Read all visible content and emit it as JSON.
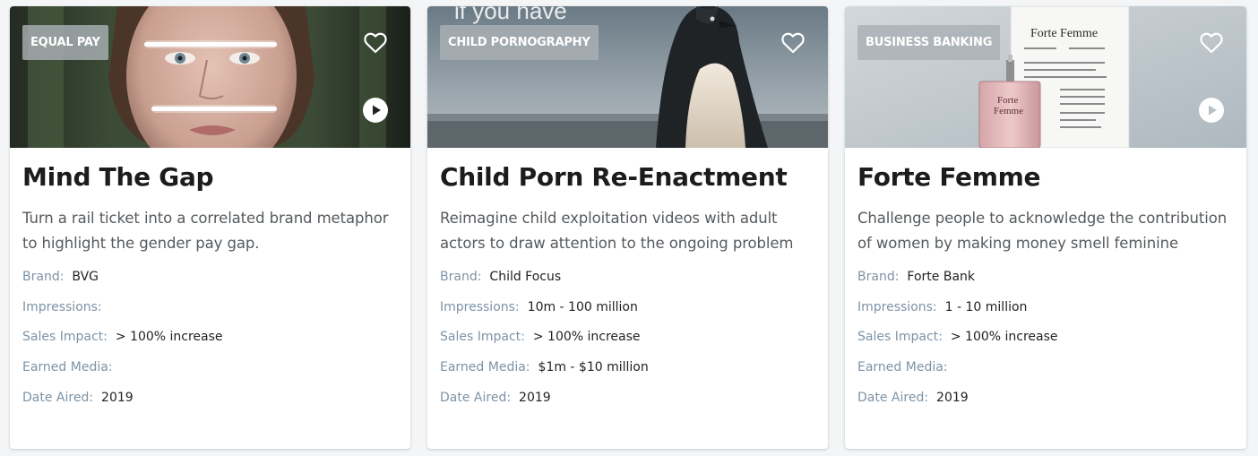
{
  "cards": [
    {
      "tag": "EQUAL PAY",
      "title": "Mind The Gap",
      "description": "Turn a rail ticket into a correlated brand metaphor to highlight the gender pay gap.",
      "fields": [
        {
          "label": "Brand:",
          "value": "BVG"
        },
        {
          "label": "Impressions:",
          "value": ""
        },
        {
          "label": "Sales Impact:",
          "value": "> 100% increase"
        },
        {
          "label": "Earned Media:",
          "value": ""
        },
        {
          "label": "Date Aired:",
          "value": "2019"
        }
      ],
      "has_video": true
    },
    {
      "tag": "CHILD PORNOGRAPHY",
      "title": "Child Porn Re-Enactment",
      "description": "Reimagine child exploitation videos with adult actors to draw attention to the ongoing problem",
      "fields": [
        {
          "label": "Brand:",
          "value": "Child Focus"
        },
        {
          "label": "Impressions:",
          "value": "10m - 100 million"
        },
        {
          "label": "Sales Impact:",
          "value": "> 100% increase"
        },
        {
          "label": "Earned Media:",
          "value": "$1m - $10 million"
        },
        {
          "label": "Date Aired:",
          "value": "2019"
        }
      ],
      "has_video": false,
      "image_text": "if you have"
    },
    {
      "tag": "BUSINESS BANKING",
      "title": "Forte Femme",
      "description": "Challenge people to acknowledge the contribution of women by making money smell feminine",
      "fields": [
        {
          "label": "Brand:",
          "value": "Forte Bank"
        },
        {
          "label": "Impressions:",
          "value": "1 - 10 million"
        },
        {
          "label": "Sales Impact:",
          "value": "> 100% increase"
        },
        {
          "label": "Earned Media:",
          "value": ""
        },
        {
          "label": "Date Aired:",
          "value": "2019"
        }
      ],
      "has_video": true,
      "image_text": "Forte Femme",
      "bottle_text": "Forte Femme"
    }
  ],
  "icons": {
    "favorite": "heart-outline-icon",
    "play": "play-circle-icon"
  }
}
